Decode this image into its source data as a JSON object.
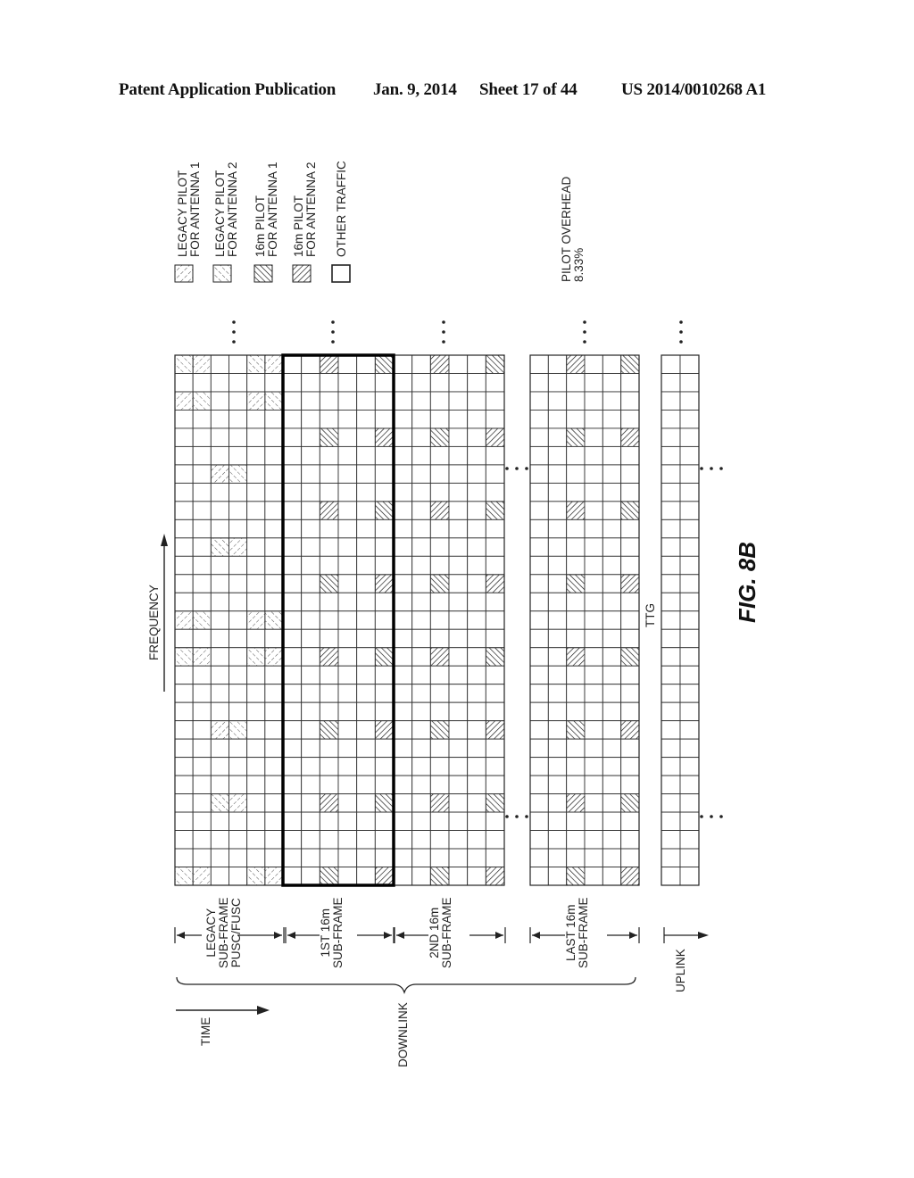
{
  "header": {
    "publication": "Patent Application Publication",
    "date": "Jan. 9, 2014",
    "sheet": "Sheet 17 of 44",
    "number": "US 2014/0010268 A1"
  },
  "figure": {
    "label": "FIG. 8B",
    "axis_time": "TIME",
    "axis_frequency": "FREQUENCY",
    "ttg_label": "TTG",
    "pilot_overhead_label": "PILOT OVERHEAD",
    "pilot_overhead_value": "8.33%",
    "downlink_label": "DOWNLINK",
    "uplink_label": "UPLINK",
    "subframes": [
      {
        "id": "legacy",
        "lines": [
          "LEGACY",
          "SUB-FRAME",
          "PUSC/FUSC"
        ],
        "columns": 6
      },
      {
        "id": "first16m",
        "lines": [
          "1ST 16m",
          "SUB-FRAME"
        ],
        "columns": 6,
        "highlighted": true
      },
      {
        "id": "second16m",
        "lines": [
          "2ND 16m",
          "SUB-FRAME"
        ],
        "columns": 6
      },
      {
        "id": "last16m",
        "lines": [
          "LAST 16m",
          "SUB-FRAME"
        ],
        "columns": 6
      },
      {
        "id": "uplink",
        "lines": [],
        "columns": 2
      }
    ],
    "rows": 29,
    "legend": [
      {
        "key": "legacy_ant1",
        "lines": [
          "LEGACY PILOT",
          "FOR ANTENNA 1"
        ]
      },
      {
        "key": "legacy_ant2",
        "lines": [
          "LEGACY PILOT",
          "FOR ANTENNA 2"
        ]
      },
      {
        "key": "m16_ant1",
        "lines": [
          "16m PILOT",
          "FOR ANTENNA 1"
        ]
      },
      {
        "key": "m16_ant2",
        "lines": [
          "16m PILOT",
          "FOR ANTENNA 2"
        ]
      },
      {
        "key": "other",
        "lines": [
          "OTHER TRAFFIC"
        ]
      }
    ]
  }
}
